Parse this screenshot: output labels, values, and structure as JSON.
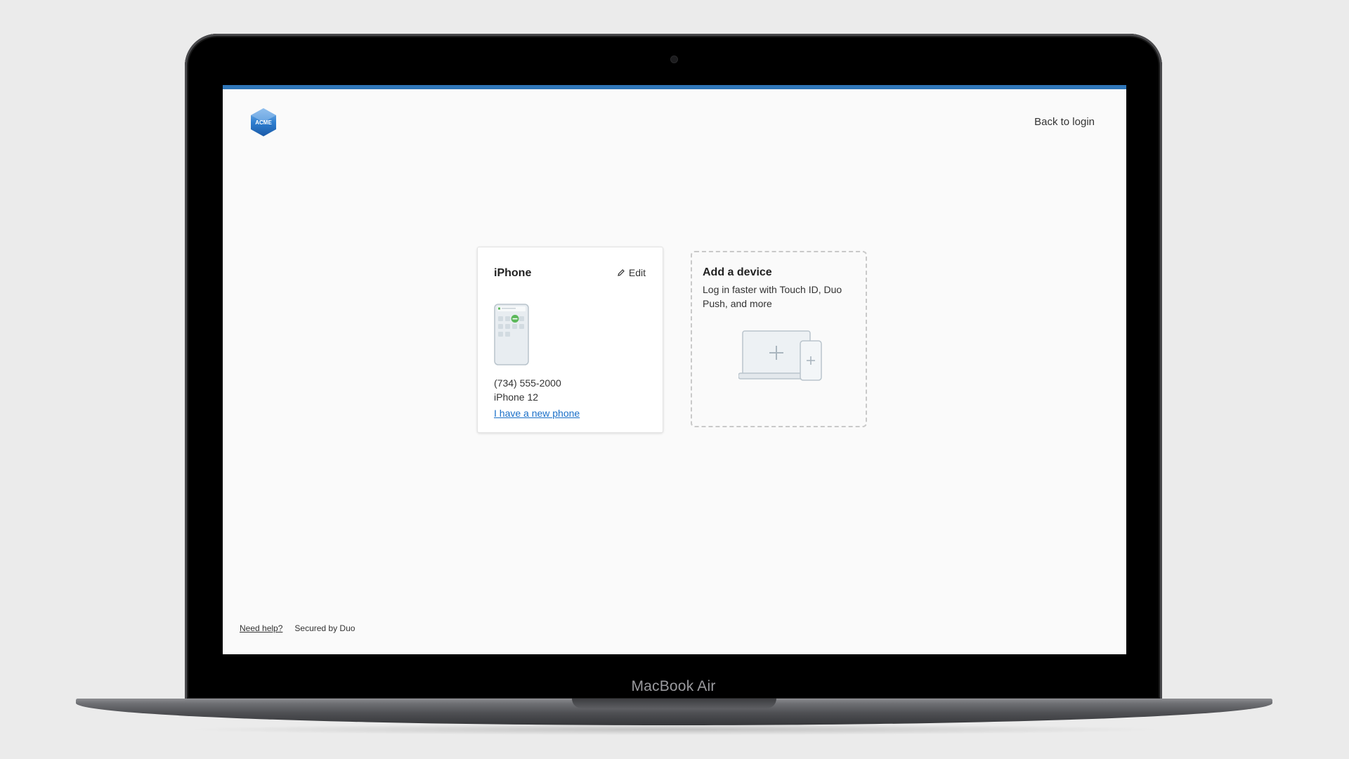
{
  "hardware": {
    "model_label": "MacBook Air"
  },
  "header": {
    "logo_text": "ACME",
    "back_link": "Back to login"
  },
  "device_card": {
    "name": "iPhone",
    "edit_label": "Edit",
    "phone_number": "(734) 555-2000",
    "model": "iPhone 12",
    "new_phone_link": "I have a new phone"
  },
  "add_device_card": {
    "title": "Add a device",
    "description": "Log in faster with Touch ID, Duo Push, and more"
  },
  "footer": {
    "help_link": "Need help?",
    "secured_text": "Secured by Duo"
  },
  "colors": {
    "accent_bar": "#2f76b9",
    "link": "#1a6fc8",
    "logo": "#2f7fd0"
  }
}
